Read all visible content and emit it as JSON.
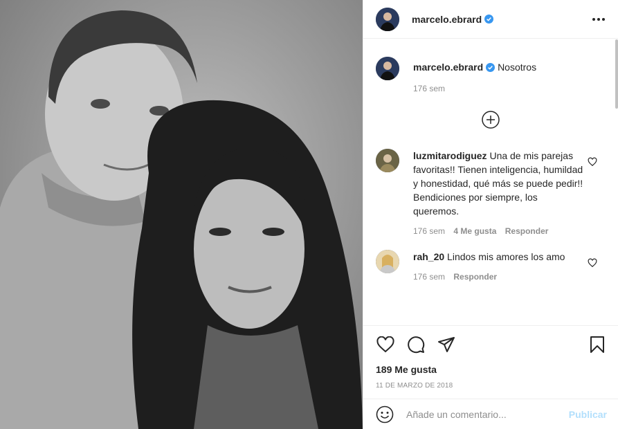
{
  "post": {
    "username": "marcelo.ebrard",
    "caption": "Nosotros",
    "caption_time": "176 sem"
  },
  "comments": [
    {
      "username": "luzmitarodiguez",
      "text": "Una de mis parejas favoritas!! Tienen inteligencia, humildad y honestidad, qué más se puede pedir!! Bendiciones por siempre, los queremos.",
      "time": "176 sem",
      "likes": "4 Me gusta",
      "reply": "Responder"
    },
    {
      "username": "rah_20",
      "text": "Lindos mis amores los amo",
      "time": "176 sem",
      "reply": "Responder"
    }
  ],
  "stats": {
    "likes": "189 Me gusta",
    "date": "11 de marzo de 2018"
  },
  "composer": {
    "placeholder": "Añade un comentario...",
    "publish": "Publicar"
  },
  "colors": {
    "verified": "#3897f0",
    "publish_disabled": "#b2dffc",
    "meta_gray": "#8e8e8e"
  },
  "icons": [
    "more-options-icon",
    "verified-icon",
    "load-more-icon",
    "heart-icon",
    "comment-icon",
    "share-icon",
    "bookmark-icon",
    "emoji-icon"
  ]
}
